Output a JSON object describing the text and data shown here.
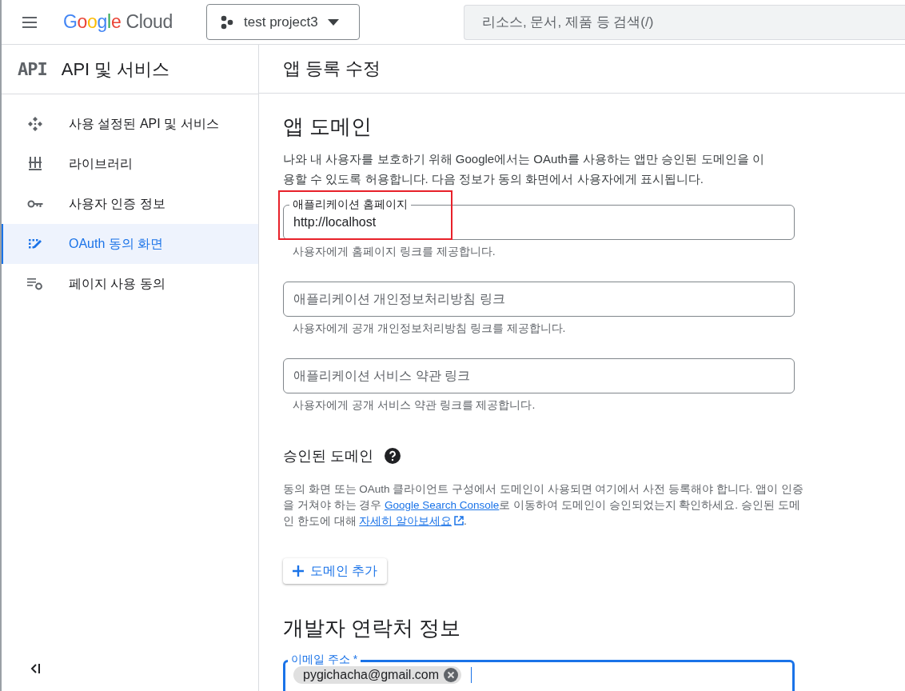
{
  "header": {
    "logo": {
      "brand": "Google",
      "product": "Cloud"
    },
    "project": "test project3",
    "search": {
      "placeholder": "리소스, 문서, 제품 등 검색(/)"
    }
  },
  "sidebar": {
    "badge": "API",
    "title": "API 및 서비스",
    "items": [
      {
        "label": "사용 설정된 API 및 서비스",
        "kind": "apis",
        "selected": false
      },
      {
        "label": "라이브러리",
        "kind": "library",
        "selected": false
      },
      {
        "label": "사용자 인증 정보",
        "kind": "key",
        "selected": false
      },
      {
        "label": "OAuth 동의 화면",
        "kind": "consent",
        "selected": true
      },
      {
        "label": "페이지 사용 동의",
        "kind": "settings",
        "selected": false
      }
    ]
  },
  "page_title": "앱 등록 수정",
  "app_domain": {
    "heading": "앱 도메인",
    "description": "나와 내 사용자를 보호하기 위해 Google에서는 OAuth를 사용하는 앱만 승인된 도메인을 이용할 수 있도록 허용합니다. 다음 정보가 동의 화면에서 사용자에게 표시됩니다.",
    "fields": [
      {
        "label": "애플리케이션 홈페이지",
        "value": "http://localhost",
        "helper": "사용자에게 홈페이지 링크를 제공합니다.",
        "highlighted": true
      },
      {
        "placeholder": "애플리케이션 개인정보처리방침 링크",
        "helper": "사용자에게 공개 개인정보처리방침 링크를 제공합니다.",
        "highlighted": false
      },
      {
        "placeholder": "애플리케이션 서비스 약관 링크",
        "helper": "사용자에게 공개 서비스 약관 링크를 제공합니다.",
        "highlighted": false
      }
    ]
  },
  "authorized_domains": {
    "heading": "승인된 도메인",
    "text": [
      {
        "kind": "text",
        "text": "동의 화면 또는 OAuth 클라이언트 구성에서 도메인이 사용되면 여기에서 사전 등록해야 합니다. 앱이 인증을 거쳐야 하는 경우 "
      },
      {
        "kind": "link",
        "text": "Google Search Console",
        "external": false
      },
      {
        "kind": "text",
        "text": "로 이동하여 도메인이 승인되었는지 확인하세요. 승인된 도메인 한도에 대해 "
      },
      {
        "kind": "link",
        "text": "자세히 알아보세요",
        "external": true
      },
      {
        "kind": "text",
        "text": "."
      }
    ],
    "add_button": "도메인 추가"
  },
  "developer_contact": {
    "heading": "개발자 연락처 정보",
    "email_field": {
      "label": "이메일 주소 *",
      "focused": true,
      "chips": [
        "pygichacha@gmail.com"
      ]
    }
  }
}
